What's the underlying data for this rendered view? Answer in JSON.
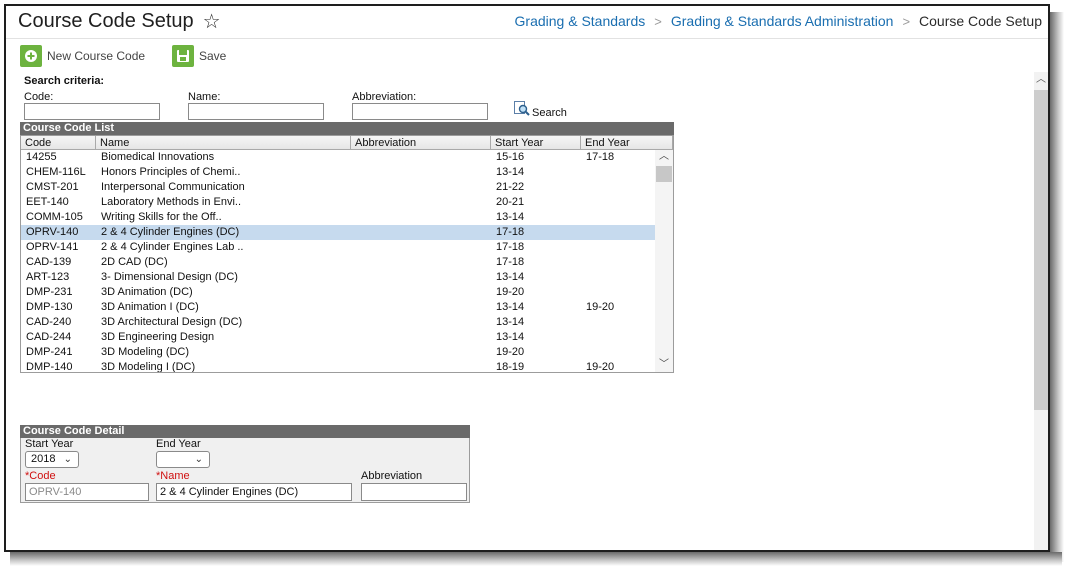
{
  "header": {
    "title": "Course Code Setup",
    "breadcrumbs": [
      "Grading & Standards",
      "Grading & Standards Administration"
    ],
    "current": "Course Code Setup"
  },
  "toolbar": {
    "new_label": "New Course Code",
    "save_label": "Save"
  },
  "search": {
    "heading": "Search criteria:",
    "code_label": "Code:",
    "name_label": "Name:",
    "abbr_label": "Abbreviation:",
    "button_label": "Search",
    "code_value": "",
    "name_value": "",
    "abbr_value": ""
  },
  "list": {
    "title": "Course Code List",
    "columns": [
      "Code",
      "Name",
      "Abbreviation",
      "Start Year",
      "End Year"
    ],
    "rows": [
      {
        "code": "14255",
        "name": "Biomedical Innovations",
        "abbr": "",
        "start": "15-16",
        "end": "17-18"
      },
      {
        "code": "CHEM-116L",
        "name": "Honors Principles of Chemi..",
        "abbr": "",
        "start": "13-14",
        "end": ""
      },
      {
        "code": "CMST-201",
        "name": "Interpersonal Communication",
        "abbr": "",
        "start": "21-22",
        "end": ""
      },
      {
        "code": "EET-140",
        "name": "Laboratory Methods in Envi..",
        "abbr": "",
        "start": "20-21",
        "end": ""
      },
      {
        "code": "COMM-105",
        "name": "Writing Skills for the Off..",
        "abbr": "",
        "start": "13-14",
        "end": ""
      },
      {
        "code": "OPRV-140",
        "name": "2 & 4 Cylinder Engines (DC)",
        "abbr": "",
        "start": "17-18",
        "end": "",
        "selected": true
      },
      {
        "code": "OPRV-141",
        "name": "2 & 4 Cylinder Engines Lab ..",
        "abbr": "",
        "start": "17-18",
        "end": ""
      },
      {
        "code": "CAD-139",
        "name": "2D CAD (DC)",
        "abbr": "",
        "start": "17-18",
        "end": ""
      },
      {
        "code": "ART-123",
        "name": "3- Dimensional Design (DC)",
        "abbr": "",
        "start": "13-14",
        "end": ""
      },
      {
        "code": "DMP-231",
        "name": "3D Animation (DC)",
        "abbr": "",
        "start": "19-20",
        "end": ""
      },
      {
        "code": "DMP-130",
        "name": "3D Animation I (DC)",
        "abbr": "",
        "start": "13-14",
        "end": "19-20"
      },
      {
        "code": "CAD-240",
        "name": "3D Architectural Design (DC)",
        "abbr": "",
        "start": "13-14",
        "end": ""
      },
      {
        "code": "CAD-244",
        "name": "3D Engineering Design",
        "abbr": "",
        "start": "13-14",
        "end": ""
      },
      {
        "code": "DMP-241",
        "name": "3D Modeling (DC)",
        "abbr": "",
        "start": "19-20",
        "end": ""
      },
      {
        "code": "DMP-140",
        "name": "3D Modeling I (DC)",
        "abbr": "",
        "start": "18-19",
        "end": "19-20"
      }
    ]
  },
  "detail": {
    "title": "Course Code Detail",
    "start_label": "Start Year",
    "end_label": "End Year",
    "start_value": "2018",
    "end_value": "",
    "code_label": "*Code",
    "name_label": "*Name",
    "abbr_label": "Abbreviation",
    "code_value": "OPRV-140",
    "name_value": "2 & 4 Cylinder Engines (DC)",
    "abbr_value": ""
  },
  "colors": {
    "link": "#1a6eb0",
    "accent_green": "#6db33f",
    "section_bar": "#6a6a6a",
    "selected_row": "#c6daee",
    "required": "#d01010"
  },
  "icons": [
    "star-icon",
    "add-icon",
    "save-icon",
    "search-icon",
    "chevron-down-icon",
    "chevron-right-icon"
  ]
}
